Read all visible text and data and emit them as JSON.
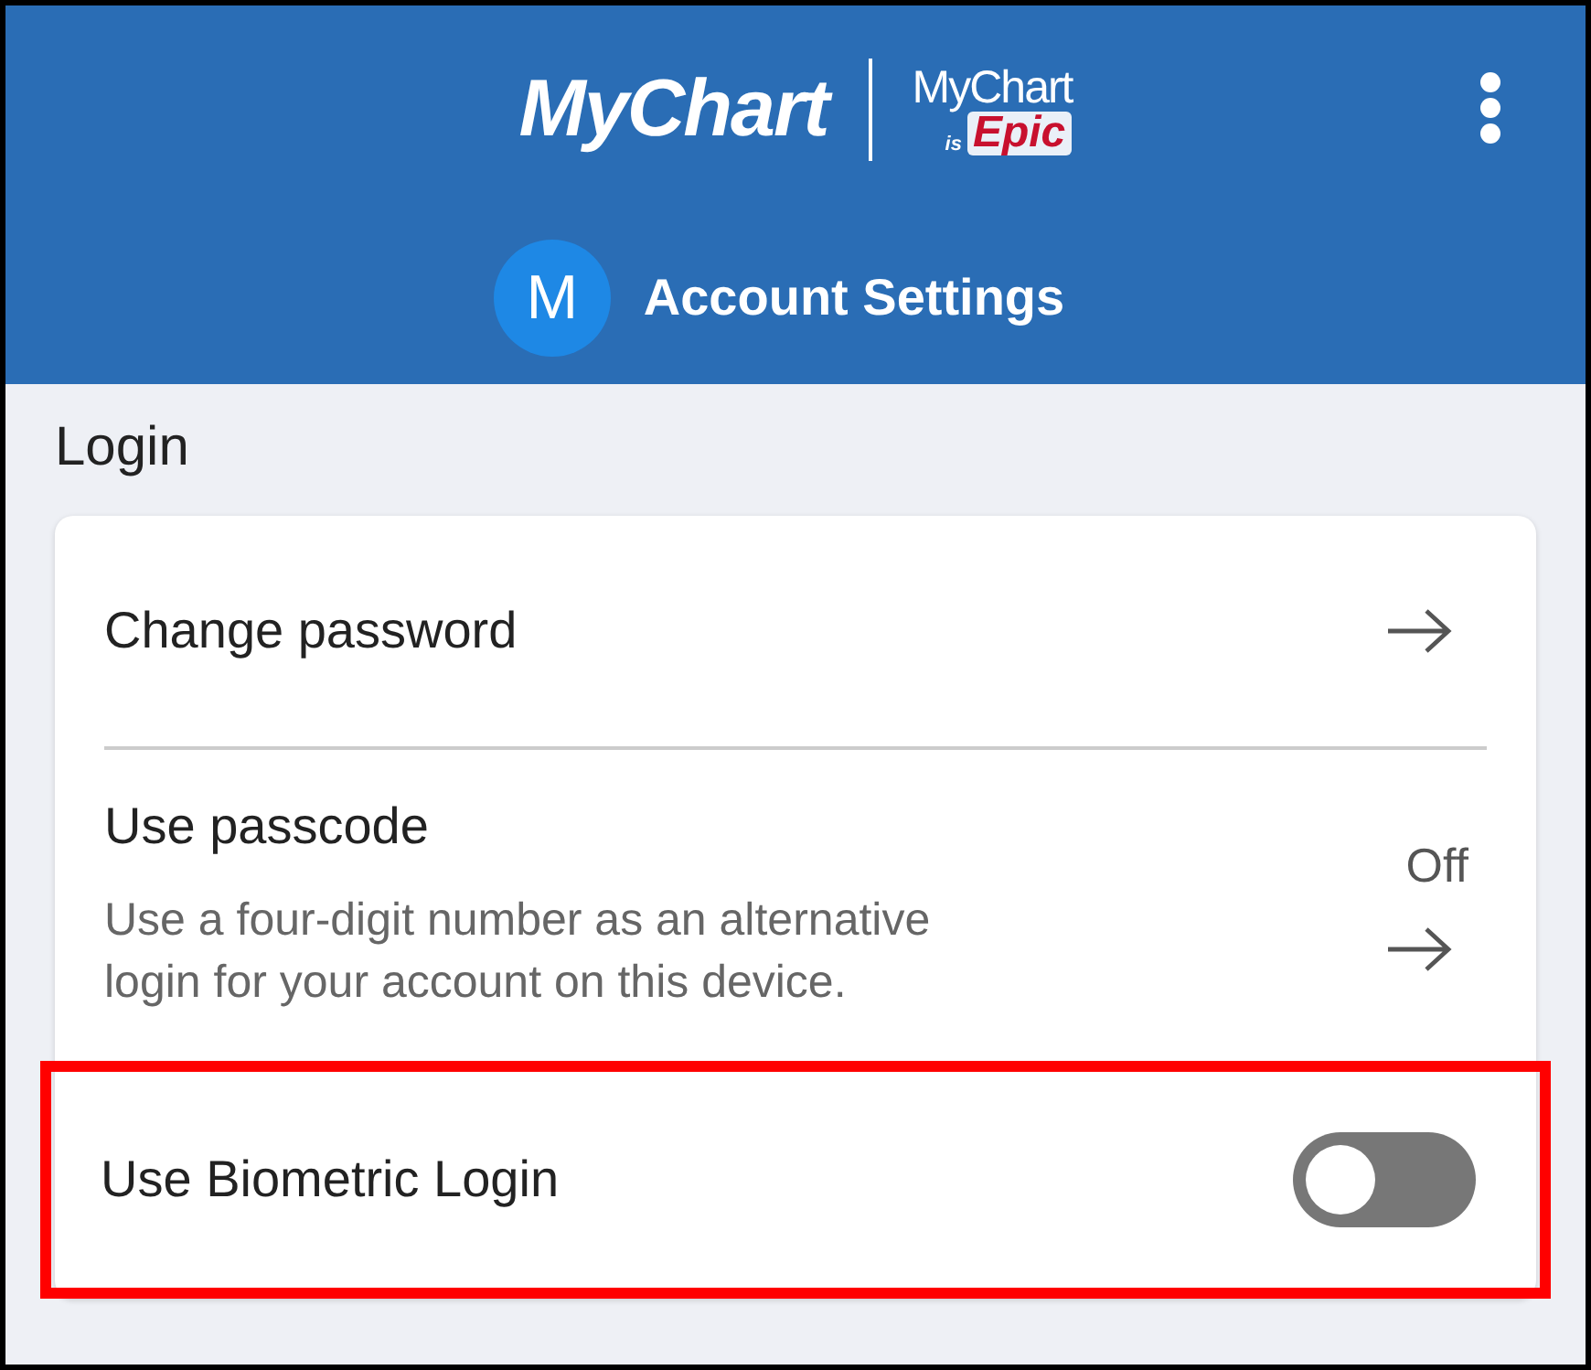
{
  "header": {
    "logo": "MyChart",
    "partner_logo": {
      "top": "MyChart",
      "is": "is",
      "brand": "Epic"
    },
    "avatar_initial": "M",
    "title": "Account Settings"
  },
  "section_title": "Login",
  "settings": [
    {
      "kind": "link",
      "label": "Change password"
    },
    {
      "kind": "link",
      "label": "Use passcode",
      "value": "Off",
      "description": "Use a four-digit number as an alternative login for your account on this device."
    },
    {
      "kind": "toggle",
      "label": "Use Biometric Login",
      "on": false,
      "highlighted": true
    }
  ]
}
